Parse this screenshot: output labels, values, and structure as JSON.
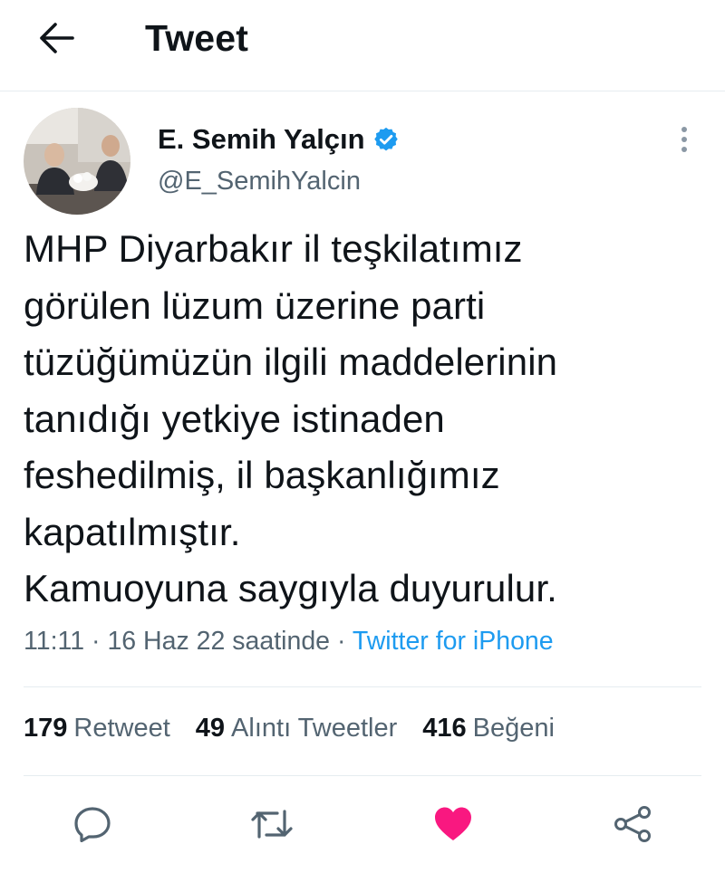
{
  "header": {
    "title": "Tweet"
  },
  "author": {
    "display_name": "E. Semih Yalçın",
    "handle": "@E_SemihYalcin",
    "verified": true
  },
  "tweet": {
    "text": "MHP Diyarbakır il teşkilatımız\ngörülen lüzum üzerine parti\ntüzüğümüzün ilgili maddelerinin\ntanıdığı yetkiye istinaden\nfeshedilmiş, il başkanlığımız\nkapatılmıştır.\nKamuoyuna saygıyla duyurulur.",
    "time": "11:11",
    "date": "16 Haz 22 saatinde",
    "separator": "·",
    "source": "Twitter for iPhone"
  },
  "stats": {
    "retweets_count": "179",
    "retweets_label": "Retweet",
    "quotes_count": "49",
    "quotes_label": "Alıntı Tweetler",
    "likes_count": "416",
    "likes_label": "Beğeni"
  },
  "icons": {
    "back": "arrow-left-icon",
    "verified": "verified-badge-icon",
    "more": "more-vertical-icon",
    "reply": "reply-icon",
    "retweet": "retweet-icon",
    "like": "heart-icon",
    "share": "share-icon"
  },
  "colors": {
    "text": "#0f1419",
    "secondary": "#536471",
    "accent": "#1d9bf0",
    "like": "#f91880",
    "divider": "#e6ecf0"
  }
}
